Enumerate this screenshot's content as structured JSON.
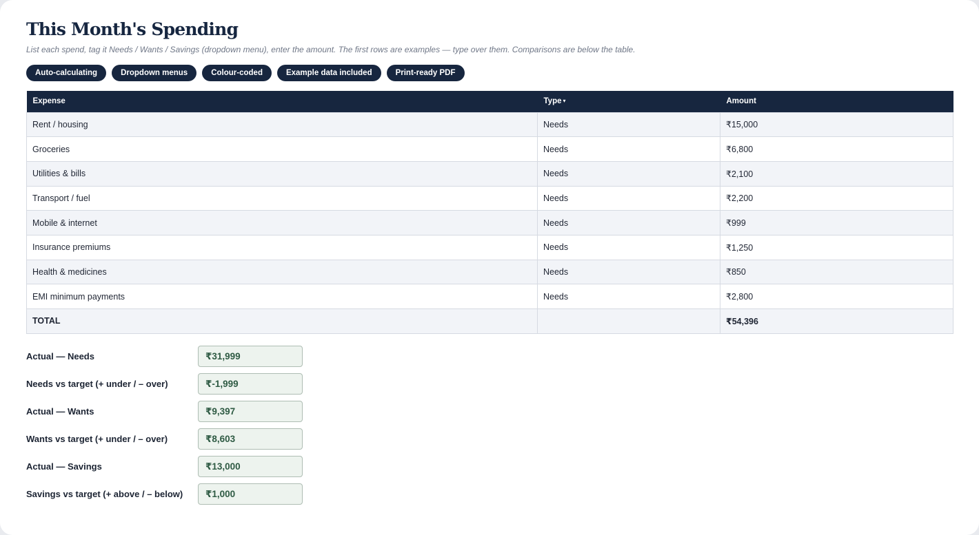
{
  "header": {
    "title": "This Month's Spending",
    "subtitle": "List each spend, tag it Needs / Wants / Savings (dropdown menu), enter the amount. The first rows are examples — type over them. Comparisons are below the table."
  },
  "chips": [
    "Auto-calculating",
    "Dropdown menus",
    "Colour-coded",
    "Example data included",
    "Print-ready PDF"
  ],
  "table": {
    "columns": {
      "expense": "Expense",
      "type": "Type",
      "type_caret": "▾",
      "amount": "Amount"
    },
    "rows": [
      {
        "expense": "Rent / housing",
        "type": "Needs",
        "amount": "₹15,000"
      },
      {
        "expense": "Groceries",
        "type": "Needs",
        "amount": "₹6,800"
      },
      {
        "expense": "Utilities & bills",
        "type": "Needs",
        "amount": "₹2,100"
      },
      {
        "expense": "Transport / fuel",
        "type": "Needs",
        "amount": "₹2,200"
      },
      {
        "expense": "Mobile & internet",
        "type": "Needs",
        "amount": "₹999"
      },
      {
        "expense": "Insurance premiums",
        "type": "Needs",
        "amount": "₹1,250"
      },
      {
        "expense": "Health & medicines",
        "type": "Needs",
        "amount": "₹850"
      },
      {
        "expense": "EMI minimum payments",
        "type": "Needs",
        "amount": "₹2,800"
      }
    ],
    "total": {
      "label": "TOTAL",
      "type": "",
      "amount": "₹54,396"
    }
  },
  "summary": [
    {
      "label": "Actual — Needs",
      "value": "₹31,999"
    },
    {
      "label": "Needs vs target (+ under / – over)",
      "value": "₹-1,999"
    },
    {
      "label": "Actual — Wants",
      "value": "₹9,397"
    },
    {
      "label": "Wants vs target (+ under / – over)",
      "value": "₹8,603"
    },
    {
      "label": "Actual — Savings",
      "value": "₹13,000"
    },
    {
      "label": "Savings vs target (+ above / – below)",
      "value": "₹1,000"
    }
  ],
  "colors": {
    "navy": "#17263f",
    "value_bg": "#edf3ee",
    "value_text": "#2e5a43"
  }
}
